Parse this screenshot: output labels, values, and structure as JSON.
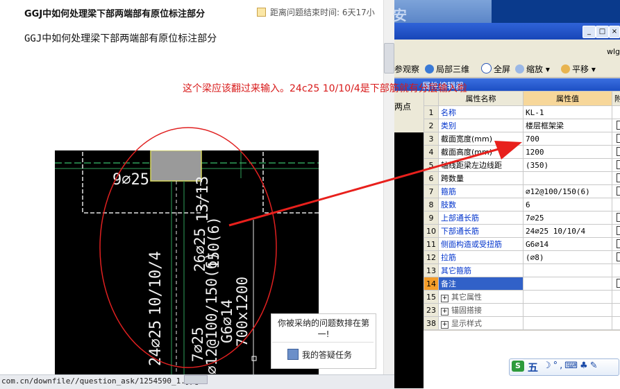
{
  "question": {
    "title_top": "GGJ中如何处理梁下部两端部有原位标注部分",
    "countdown": "距离问题结束时间: 6天17小",
    "title_body": "GGJ中如何处理梁下部两端部有原位标注部分"
  },
  "annotation": {
    "answer_text": "这个梁应该翻过来输入。24c25 10/10/4是下部筋就有分层输入啦",
    "ellipse_color": "#e02020",
    "arrow_color": "#e8201c"
  },
  "cad": {
    "text_9c25": "9⌀25",
    "text_13_3": "13/13",
    "text_26c25": "26⌀25",
    "text_150_6": "150(6)",
    "text_10_10_4": "10/10/4",
    "text_24c25": "24⌀25",
    "text_7c25": "7⌀25",
    "text_c12": "⌀12@100/150(6)",
    "text_g6": "G6⌀14",
    "text_700": "700x1200"
  },
  "popup": {
    "message": "你被采纳的问题数排在第一!",
    "link": "我的答疑任务"
  },
  "status": {
    "url": "com.cn/downfile//question_ask/1254590_1.jpg"
  },
  "app": {
    "banner_char": "安",
    "window_buttons": [
      "_",
      "□",
      "×"
    ],
    "menu_label": "wlg",
    "toolbar": {
      "observe": "参观察",
      "local3d": "局部三维",
      "fullscreen": "全屏",
      "zoom": "缩放",
      "pan": "平移"
    },
    "editor_title": "属性编辑器",
    "left_strip_label": "两点",
    "grid": {
      "headers": [
        "",
        "属性名称",
        "属性值",
        "附"
      ],
      "rows": [
        {
          "n": "1",
          "name": "名称",
          "value": "KL-1",
          "check": false,
          "color": "blue"
        },
        {
          "n": "2",
          "name": "类别",
          "value": "楼层框架梁",
          "check": true,
          "color": "blue"
        },
        {
          "n": "3",
          "name": "截面宽度(mm)",
          "value": "700",
          "check": true,
          "color": "black"
        },
        {
          "n": "4",
          "name": "截面高度(mm)",
          "value": "1200",
          "check": true,
          "color": "black"
        },
        {
          "n": "5",
          "name": "轴线距梁左边线距",
          "value": "(350)",
          "check": true,
          "color": "black"
        },
        {
          "n": "6",
          "name": "跨数量",
          "value": "",
          "check": true,
          "color": "black"
        },
        {
          "n": "7",
          "name": "箍筋",
          "value": "⌀12@100/150(6)",
          "check": true,
          "color": "blue"
        },
        {
          "n": "8",
          "name": "肢数",
          "value": "6",
          "check": false,
          "color": "blue"
        },
        {
          "n": "9",
          "name": "上部通长筋",
          "value": "7⌀25",
          "check": true,
          "color": "blue"
        },
        {
          "n": "10",
          "name": "下部通长筋",
          "value": "24⌀25 10/10/4",
          "check": true,
          "color": "blue"
        },
        {
          "n": "11",
          "name": "侧面构造或受扭筋",
          "value": "G6⌀14",
          "check": true,
          "color": "blue"
        },
        {
          "n": "12",
          "name": "拉筋",
          "value": "(⌀8)",
          "check": true,
          "color": "blue"
        },
        {
          "n": "13",
          "name": "其它箍筋",
          "value": "",
          "check": false,
          "color": "blue"
        },
        {
          "n": "14",
          "name": "备注",
          "value": "",
          "check": true,
          "color": "selected"
        },
        {
          "n": "15",
          "name": "其它属性",
          "value": "",
          "check": false,
          "color": "grey",
          "expand": true
        },
        {
          "n": "23",
          "name": "锚固搭接",
          "value": "",
          "check": false,
          "color": "grey",
          "expand": true
        },
        {
          "n": "38",
          "name": "显示样式",
          "value": "",
          "check": false,
          "color": "grey",
          "expand": true
        }
      ]
    },
    "ime": {
      "logo": "S",
      "mode": "五",
      "icons": "☽°,⌨♣✎"
    }
  }
}
